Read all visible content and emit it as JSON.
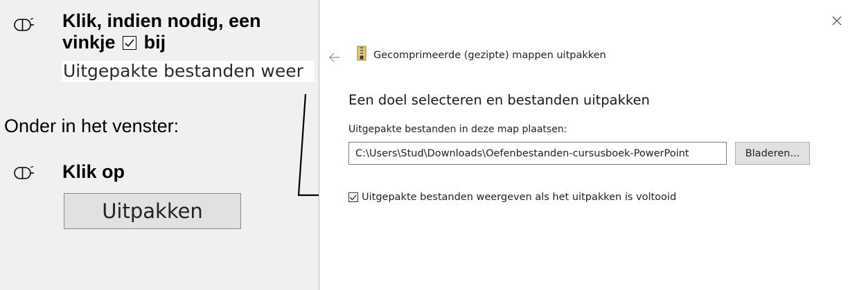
{
  "instructions": {
    "step1_line1": "Klik, indien nodig, een",
    "step1_line2_prefix": "vinkje",
    "step1_line2_suffix": "bij",
    "step1_option_snippet": "Uitgepakte bestanden weer",
    "bottom_note": "Onder in het venster:",
    "step2_label": "Klik op",
    "step2_button_label": "Uitpakken"
  },
  "dialog": {
    "title": "Gecomprimeerde (gezipte) mappen uitpakken",
    "heading": "Een doel selecteren en bestanden uitpakken",
    "path_label": "Uitgepakte bestanden in deze map plaatsen:",
    "path_value": "C:\\Users\\Stud\\Downloads\\Oefenbestanden-cursusboek-PowerPoint",
    "browse_label": "Bladeren...",
    "show_files_label": "Uitgepakte bestanden weergeven als het uitpakken is voltooid",
    "show_files_checked": true
  },
  "icons": {
    "step_icon": "mouse-pointer-icon",
    "close": "close-icon",
    "back": "back-arrow-icon",
    "zip": "zip-folder-icon"
  }
}
